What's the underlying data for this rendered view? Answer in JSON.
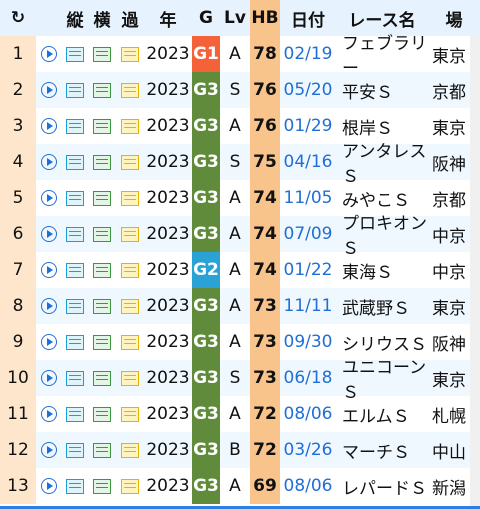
{
  "header": {
    "refresh_icon": "↻",
    "tate": "縦",
    "yoko": "横",
    "kako": "過",
    "year": "年",
    "g": "G",
    "lv": "Lv",
    "hb": "HB",
    "date": "日付",
    "race": "レース名",
    "place": "場"
  },
  "rows": [
    {
      "num": "1",
      "year": "2023",
      "g": "G1",
      "lv": "A",
      "hb": "78",
      "date": "02/19",
      "race": "フェブラリー",
      "place": "東京"
    },
    {
      "num": "2",
      "year": "2023",
      "g": "G3",
      "lv": "S",
      "hb": "76",
      "date": "05/20",
      "race": "平安Ｓ",
      "place": "京都"
    },
    {
      "num": "3",
      "year": "2023",
      "g": "G3",
      "lv": "A",
      "hb": "76",
      "date": "01/29",
      "race": "根岸Ｓ",
      "place": "東京"
    },
    {
      "num": "4",
      "year": "2023",
      "g": "G3",
      "lv": "S",
      "hb": "75",
      "date": "04/16",
      "race": "アンタレスＳ",
      "place": "阪神"
    },
    {
      "num": "5",
      "year": "2023",
      "g": "G3",
      "lv": "A",
      "hb": "74",
      "date": "11/05",
      "race": "みやこＳ",
      "place": "京都"
    },
    {
      "num": "6",
      "year": "2023",
      "g": "G3",
      "lv": "A",
      "hb": "74",
      "date": "07/09",
      "race": "プロキオンＳ",
      "place": "中京"
    },
    {
      "num": "7",
      "year": "2023",
      "g": "G2",
      "lv": "A",
      "hb": "74",
      "date": "01/22",
      "race": "東海Ｓ",
      "place": "中京"
    },
    {
      "num": "8",
      "year": "2023",
      "g": "G3",
      "lv": "A",
      "hb": "73",
      "date": "11/11",
      "race": "武蔵野Ｓ",
      "place": "東京"
    },
    {
      "num": "9",
      "year": "2023",
      "g": "G3",
      "lv": "A",
      "hb": "73",
      "date": "09/30",
      "race": "シリウスＳ",
      "place": "阪神"
    },
    {
      "num": "10",
      "year": "2023",
      "g": "G3",
      "lv": "S",
      "hb": "73",
      "date": "06/18",
      "race": "ユニコーンＳ",
      "place": "東京"
    },
    {
      "num": "11",
      "year": "2023",
      "g": "G3",
      "lv": "A",
      "hb": "72",
      "date": "08/06",
      "race": "エルムＳ",
      "place": "札幌"
    },
    {
      "num": "12",
      "year": "2023",
      "g": "G3",
      "lv": "B",
      "hb": "72",
      "date": "03/26",
      "race": "マーチＳ",
      "place": "中山"
    },
    {
      "num": "13",
      "year": "2023",
      "g": "G3",
      "lv": "A",
      "hb": "69",
      "date": "08/06",
      "race": "レパードＳ",
      "place": "新潟"
    }
  ],
  "colors": {
    "G1": "#f4623a",
    "G2": "#2ba2d6",
    "G3": "#5f8b3a",
    "hb": "#f9c48c",
    "accent": "#1f6fd6"
  },
  "icons": {
    "play": "play-circle-icon",
    "tate": "vertical-sheet-icon",
    "yoko": "horizontal-sheet-icon",
    "kako": "history-sheet-icon"
  }
}
